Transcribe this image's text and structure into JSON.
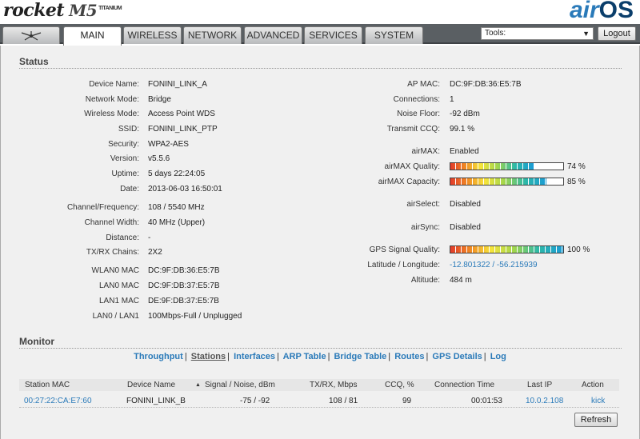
{
  "brand": {
    "product": "rocket",
    "model": "M5",
    "edition": "TITANIUM",
    "os_air": "air",
    "os_name": "OS"
  },
  "tabs": [
    {
      "label": ""
    },
    {
      "label": "MAIN"
    },
    {
      "label": "WIRELESS"
    },
    {
      "label": "NETWORK"
    },
    {
      "label": "ADVANCED"
    },
    {
      "label": "SERVICES"
    },
    {
      "label": "SYSTEM"
    }
  ],
  "tools": {
    "selected": "Tools:"
  },
  "logout_label": "Logout",
  "status": {
    "title": "Status",
    "left": [
      {
        "label": "Device Name:",
        "value": "FONINI_LINK_A"
      },
      {
        "label": "Network Mode:",
        "value": "Bridge"
      },
      {
        "label": "Wireless Mode:",
        "value": "Access Point WDS"
      },
      {
        "label": "SSID:",
        "value": "FONINI_LINK_PTP"
      },
      {
        "label": "Security:",
        "value": "WPA2-AES"
      },
      {
        "label": "Version:",
        "value": "v5.5.6"
      },
      {
        "label": "Uptime:",
        "value": "5 days 22:24:05"
      },
      {
        "label": "Date:",
        "value": "2013-06-03 16:50:01"
      },
      {
        "label": "Channel/Frequency:",
        "value": "108 / 5540 MHz"
      },
      {
        "label": "Channel Width:",
        "value": "40 MHz (Upper)"
      },
      {
        "label": "Distance:",
        "value": "-"
      },
      {
        "label": "TX/RX Chains:",
        "value": "2X2"
      },
      {
        "label": "WLAN0 MAC",
        "value": "DC:9F:DB:36:E5:7B"
      },
      {
        "label": "LAN0 MAC",
        "value": "DC:9F:DB:37:E5:7B"
      },
      {
        "label": "LAN1 MAC",
        "value": "DE:9F:DB:37:E5:7B"
      },
      {
        "label": "LAN0 / LAN1",
        "value": "100Mbps-Full / Unplugged"
      }
    ],
    "right": {
      "ap_mac": {
        "label": "AP MAC:",
        "value": "DC:9F:DB:36:E5:7B"
      },
      "connections": {
        "label": "Connections:",
        "value": "1"
      },
      "noise_floor": {
        "label": "Noise Floor:",
        "value": "-92 dBm"
      },
      "transmit_ccq": {
        "label": "Transmit CCQ:",
        "value": "99.1 %"
      },
      "airmax": {
        "label": "airMAX:",
        "value": "Enabled"
      },
      "airmax_quality": {
        "label": "airMAX Quality:",
        "percent": 74,
        "text": "74 %"
      },
      "airmax_capacity": {
        "label": "airMAX Capacity:",
        "percent": 85,
        "text": "85 %"
      },
      "airselect": {
        "label": "airSelect:",
        "value": "Disabled"
      },
      "airsync": {
        "label": "airSync:",
        "value": "Disabled"
      },
      "gps_quality": {
        "label": "GPS Signal Quality:",
        "percent": 100,
        "text": "100 %"
      },
      "lat_long": {
        "label": "Latitude / Longitude:",
        "value": "-12.801322 / -56.215939"
      },
      "altitude": {
        "label": "Altitude:",
        "value": "484 m"
      }
    }
  },
  "monitor": {
    "title": "Monitor",
    "links": [
      "Throughput",
      "Stations",
      "Interfaces",
      "ARP Table",
      "Bridge Table",
      "Routes",
      "GPS Details",
      "Log"
    ],
    "active_link": "Stations",
    "columns": [
      "Station MAC",
      "Device Name",
      "Signal / Noise, dBm",
      "TX/RX, Mbps",
      "CCQ, %",
      "Connection Time",
      "Last IP",
      "Action"
    ],
    "rows": [
      {
        "station_mac": "00:27:22:CA:E7:60",
        "device_name": "FONINI_LINK_B",
        "signal_noise": "-75 / -92",
        "tx_rx": "108 / 81",
        "ccq": "99",
        "connection_time": "00:01:53",
        "last_ip": "10.0.2.108",
        "action": "kick"
      }
    ],
    "sort_indicator": "▲",
    "refresh_label": "Refresh"
  },
  "colors": {
    "link": "#2a7ab9",
    "nav_bg": "#5a5f63",
    "os_dark": "#0a3e6b"
  }
}
